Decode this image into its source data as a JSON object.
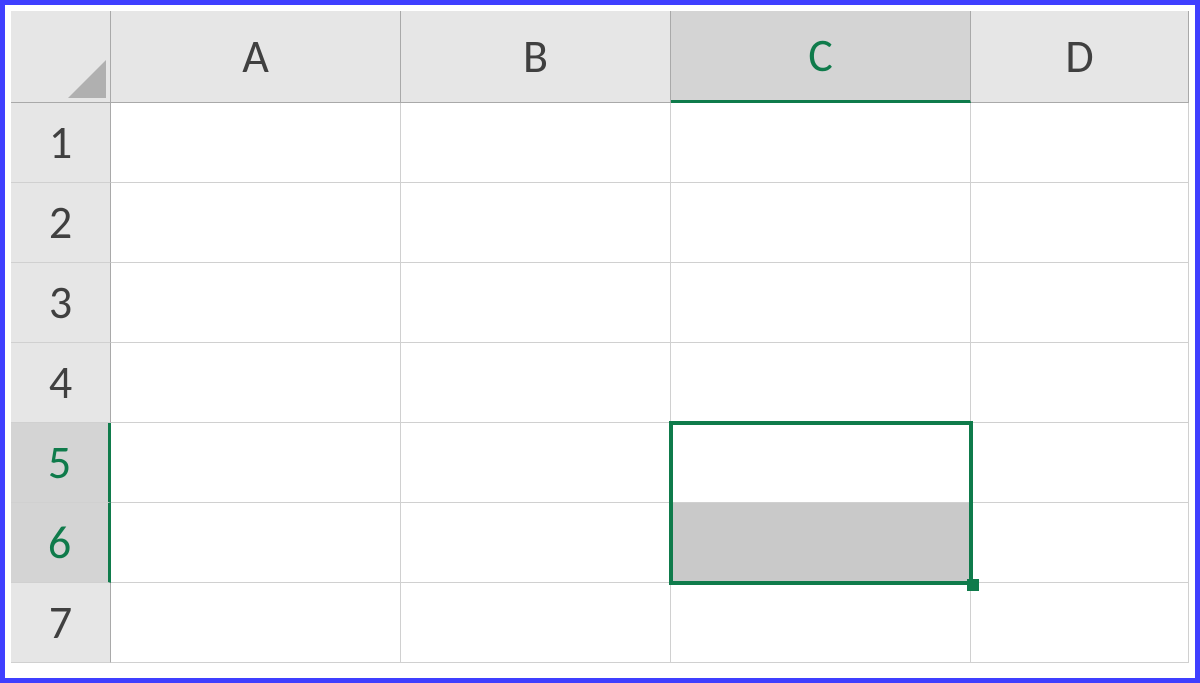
{
  "columns": [
    "A",
    "B",
    "C",
    "D"
  ],
  "rows": [
    "1",
    "2",
    "3",
    "4",
    "5",
    "6",
    "7"
  ],
  "selection": {
    "active_cell": "C5",
    "range": "C5:C6",
    "selected_columns": [
      "C"
    ],
    "selected_rows": [
      "5",
      "6"
    ]
  },
  "colors": {
    "selection_border": "#0f7b4b",
    "header_bg": "#e6e6e6",
    "header_selected_bg": "#d4d4d4",
    "frame_border": "#3f3fff"
  }
}
